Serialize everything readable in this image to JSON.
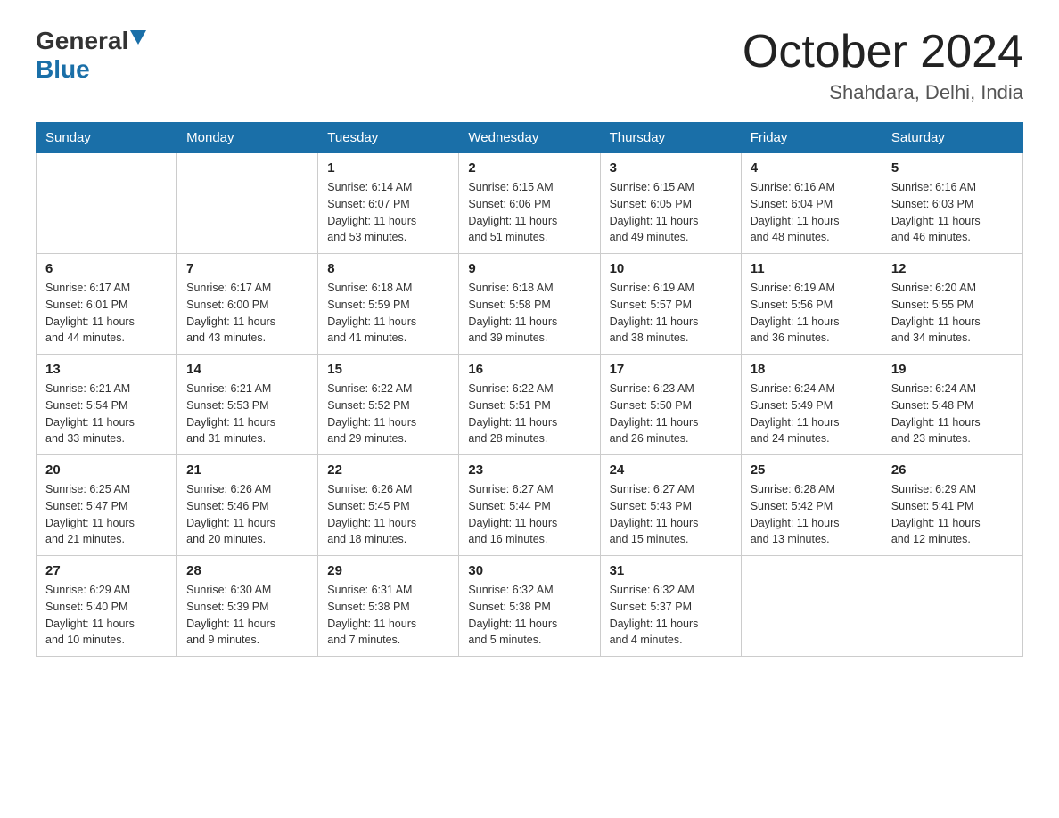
{
  "header": {
    "logo": {
      "general_text": "General",
      "blue_text": "Blue"
    },
    "month_title": "October 2024",
    "location": "Shahdara, Delhi, India"
  },
  "calendar": {
    "days_of_week": [
      "Sunday",
      "Monday",
      "Tuesday",
      "Wednesday",
      "Thursday",
      "Friday",
      "Saturday"
    ],
    "weeks": [
      [
        {
          "day": "",
          "info": ""
        },
        {
          "day": "",
          "info": ""
        },
        {
          "day": "1",
          "info": "Sunrise: 6:14 AM\nSunset: 6:07 PM\nDaylight: 11 hours\nand 53 minutes."
        },
        {
          "day": "2",
          "info": "Sunrise: 6:15 AM\nSunset: 6:06 PM\nDaylight: 11 hours\nand 51 minutes."
        },
        {
          "day": "3",
          "info": "Sunrise: 6:15 AM\nSunset: 6:05 PM\nDaylight: 11 hours\nand 49 minutes."
        },
        {
          "day": "4",
          "info": "Sunrise: 6:16 AM\nSunset: 6:04 PM\nDaylight: 11 hours\nand 48 minutes."
        },
        {
          "day": "5",
          "info": "Sunrise: 6:16 AM\nSunset: 6:03 PM\nDaylight: 11 hours\nand 46 minutes."
        }
      ],
      [
        {
          "day": "6",
          "info": "Sunrise: 6:17 AM\nSunset: 6:01 PM\nDaylight: 11 hours\nand 44 minutes."
        },
        {
          "day": "7",
          "info": "Sunrise: 6:17 AM\nSunset: 6:00 PM\nDaylight: 11 hours\nand 43 minutes."
        },
        {
          "day": "8",
          "info": "Sunrise: 6:18 AM\nSunset: 5:59 PM\nDaylight: 11 hours\nand 41 minutes."
        },
        {
          "day": "9",
          "info": "Sunrise: 6:18 AM\nSunset: 5:58 PM\nDaylight: 11 hours\nand 39 minutes."
        },
        {
          "day": "10",
          "info": "Sunrise: 6:19 AM\nSunset: 5:57 PM\nDaylight: 11 hours\nand 38 minutes."
        },
        {
          "day": "11",
          "info": "Sunrise: 6:19 AM\nSunset: 5:56 PM\nDaylight: 11 hours\nand 36 minutes."
        },
        {
          "day": "12",
          "info": "Sunrise: 6:20 AM\nSunset: 5:55 PM\nDaylight: 11 hours\nand 34 minutes."
        }
      ],
      [
        {
          "day": "13",
          "info": "Sunrise: 6:21 AM\nSunset: 5:54 PM\nDaylight: 11 hours\nand 33 minutes."
        },
        {
          "day": "14",
          "info": "Sunrise: 6:21 AM\nSunset: 5:53 PM\nDaylight: 11 hours\nand 31 minutes."
        },
        {
          "day": "15",
          "info": "Sunrise: 6:22 AM\nSunset: 5:52 PM\nDaylight: 11 hours\nand 29 minutes."
        },
        {
          "day": "16",
          "info": "Sunrise: 6:22 AM\nSunset: 5:51 PM\nDaylight: 11 hours\nand 28 minutes."
        },
        {
          "day": "17",
          "info": "Sunrise: 6:23 AM\nSunset: 5:50 PM\nDaylight: 11 hours\nand 26 minutes."
        },
        {
          "day": "18",
          "info": "Sunrise: 6:24 AM\nSunset: 5:49 PM\nDaylight: 11 hours\nand 24 minutes."
        },
        {
          "day": "19",
          "info": "Sunrise: 6:24 AM\nSunset: 5:48 PM\nDaylight: 11 hours\nand 23 minutes."
        }
      ],
      [
        {
          "day": "20",
          "info": "Sunrise: 6:25 AM\nSunset: 5:47 PM\nDaylight: 11 hours\nand 21 minutes."
        },
        {
          "day": "21",
          "info": "Sunrise: 6:26 AM\nSunset: 5:46 PM\nDaylight: 11 hours\nand 20 minutes."
        },
        {
          "day": "22",
          "info": "Sunrise: 6:26 AM\nSunset: 5:45 PM\nDaylight: 11 hours\nand 18 minutes."
        },
        {
          "day": "23",
          "info": "Sunrise: 6:27 AM\nSunset: 5:44 PM\nDaylight: 11 hours\nand 16 minutes."
        },
        {
          "day": "24",
          "info": "Sunrise: 6:27 AM\nSunset: 5:43 PM\nDaylight: 11 hours\nand 15 minutes."
        },
        {
          "day": "25",
          "info": "Sunrise: 6:28 AM\nSunset: 5:42 PM\nDaylight: 11 hours\nand 13 minutes."
        },
        {
          "day": "26",
          "info": "Sunrise: 6:29 AM\nSunset: 5:41 PM\nDaylight: 11 hours\nand 12 minutes."
        }
      ],
      [
        {
          "day": "27",
          "info": "Sunrise: 6:29 AM\nSunset: 5:40 PM\nDaylight: 11 hours\nand 10 minutes."
        },
        {
          "day": "28",
          "info": "Sunrise: 6:30 AM\nSunset: 5:39 PM\nDaylight: 11 hours\nand 9 minutes."
        },
        {
          "day": "29",
          "info": "Sunrise: 6:31 AM\nSunset: 5:38 PM\nDaylight: 11 hours\nand 7 minutes."
        },
        {
          "day": "30",
          "info": "Sunrise: 6:32 AM\nSunset: 5:38 PM\nDaylight: 11 hours\nand 5 minutes."
        },
        {
          "day": "31",
          "info": "Sunrise: 6:32 AM\nSunset: 5:37 PM\nDaylight: 11 hours\nand 4 minutes."
        },
        {
          "day": "",
          "info": ""
        },
        {
          "day": "",
          "info": ""
        }
      ]
    ]
  }
}
